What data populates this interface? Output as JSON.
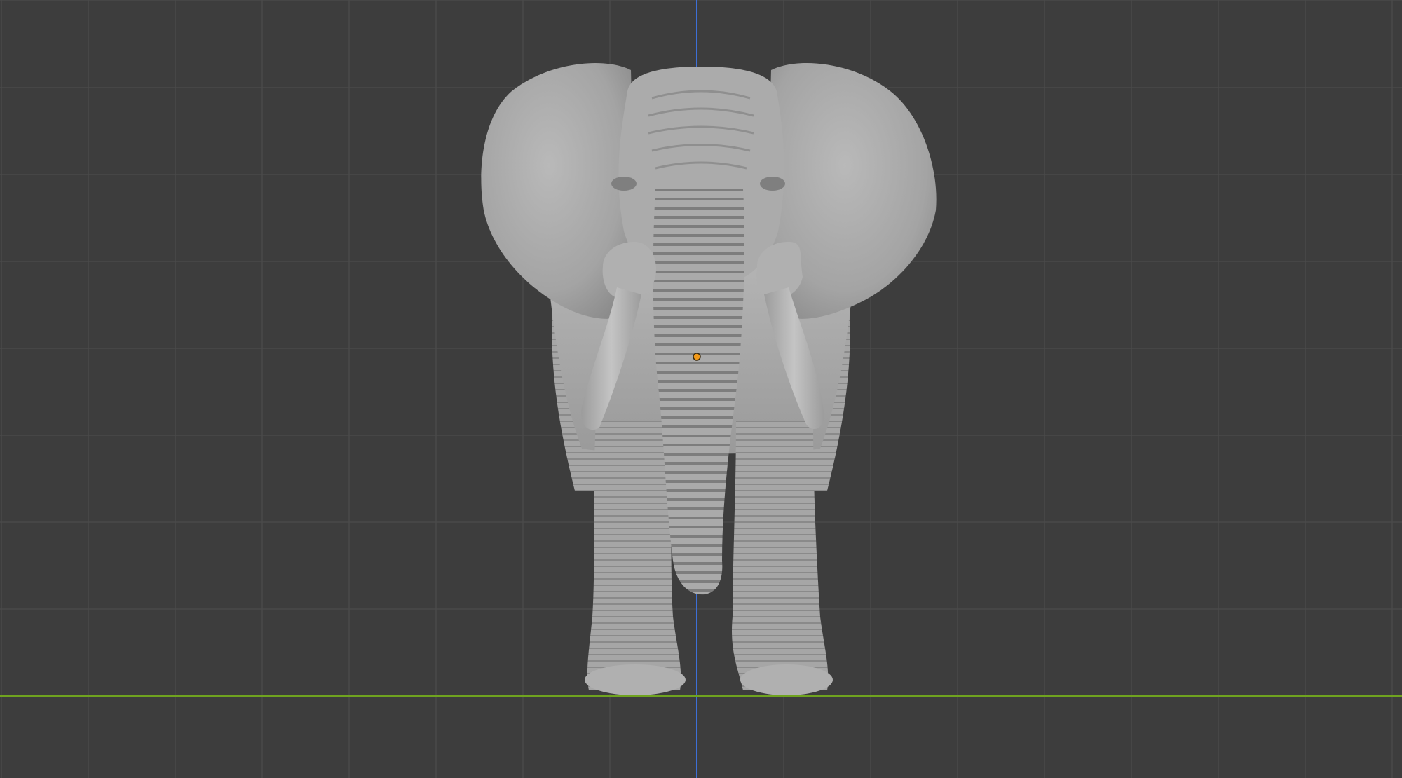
{
  "viewport": {
    "background_color": "#3d3d3d",
    "grid_color": "#4a4a4a",
    "x_axis_color": "#6fa31f",
    "z_axis_color": "#3d6fd6",
    "mesh_color": "#a9a9a9",
    "origin_color": "#f29a1a"
  },
  "scene": {
    "object_icon": "elephant-mesh",
    "origin_icon": "object-origin-dot"
  }
}
